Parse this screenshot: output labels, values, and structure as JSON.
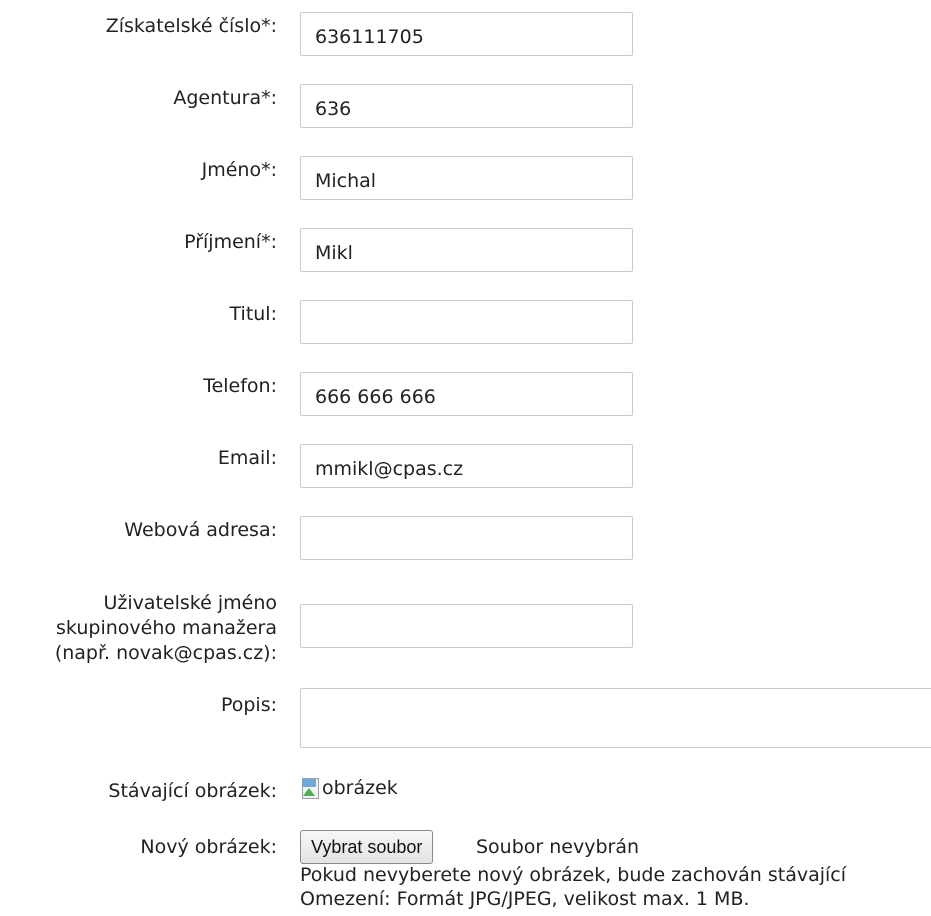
{
  "form": {
    "fields": [
      {
        "label": "Získatelské číslo*:",
        "value": "636111705"
      },
      {
        "label": "Agentura*:",
        "value": "636"
      },
      {
        "label": "Jméno*:",
        "value": "Michal"
      },
      {
        "label": "Příjmení*:",
        "value": "Mikl"
      },
      {
        "label": "Titul:",
        "value": ""
      },
      {
        "label": "Telefon:",
        "value": "666 666 666"
      },
      {
        "label": "Email:",
        "value": "mmikl@cpas.cz"
      },
      {
        "label": "Webová adresa:",
        "value": ""
      },
      {
        "label_lines": [
          "Uživatelské jméno",
          "skupinového manažera",
          "(např. novak@cpas.cz):"
        ],
        "value": ""
      }
    ],
    "description": {
      "label": "Popis:",
      "value": ""
    },
    "current_image": {
      "label": "Stávající obrázek:",
      "alt": "obrázek",
      "icon": "broken-image-icon"
    },
    "new_image": {
      "label": "Nový obrázek:",
      "button": "Vybrat soubor",
      "status": "Soubor nevybrán",
      "note_line1": "Pokud nevyberete nový obrázek, bude zachován stávající",
      "note_line2": "Omezení: Formát JPG/JPEG, velikost max. 1 MB."
    }
  }
}
